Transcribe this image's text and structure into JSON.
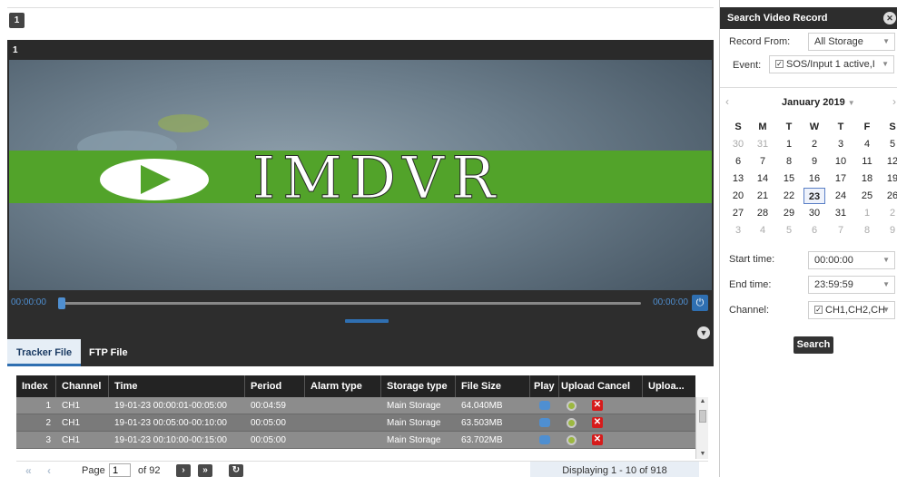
{
  "player": {
    "window_badge": "1",
    "channel_number": "1",
    "logo_text": "IMDVR",
    "time_start": "00:00:00",
    "time_end": "00:00:00",
    "progress_fraction": 0
  },
  "tabs": [
    {
      "label": "Tracker File",
      "active": true
    },
    {
      "label": "FTP File",
      "active": false
    }
  ],
  "table": {
    "columns": [
      "Index",
      "Channel",
      "Time",
      "Period",
      "Alarm type",
      "Storage type",
      "File Size",
      "Play",
      "Upload",
      "Cancel",
      "Uploa..."
    ],
    "rows": [
      {
        "index": "1",
        "channel": "CH1",
        "time": "19-01-23 00:00:01-00:05:00",
        "period": "00:04:59",
        "alarm_type": "",
        "storage_type": "Main Storage",
        "file_size": "64.040MB",
        "cancel": "✕"
      },
      {
        "index": "2",
        "channel": "CH1",
        "time": "19-01-23 00:05:00-00:10:00",
        "period": "00:05:00",
        "alarm_type": "",
        "storage_type": "Main Storage",
        "file_size": "63.503MB",
        "cancel": "✕"
      },
      {
        "index": "3",
        "channel": "CH1",
        "time": "19-01-23 00:10:00-00:15:00",
        "period": "00:05:00",
        "alarm_type": "",
        "storage_type": "Main Storage",
        "file_size": "63.702MB",
        "cancel": "✕"
      }
    ]
  },
  "pager": {
    "first": "«",
    "prev": "‹",
    "page_label": "Page",
    "page_value": "1",
    "of_label": "of 92",
    "next": "›",
    "last": "»",
    "refresh": "↻",
    "displaying": "Displaying 1 - 10 of 918"
  },
  "search_panel": {
    "title": "Search Video Record",
    "close": "✕",
    "record_from_label": "Record From:",
    "record_from_value": "All Storage",
    "event_label": "Event:",
    "event_value": "SOS/Input 1 active,I",
    "event_checked": "✓",
    "calendar": {
      "month_title": "January 2019",
      "prev": "‹",
      "next": "›",
      "weekdays": [
        "S",
        "M",
        "T",
        "W",
        "T",
        "F",
        "S"
      ],
      "weeks": [
        [
          "30",
          "31",
          "1",
          "2",
          "3",
          "4",
          "5"
        ],
        [
          "6",
          "7",
          "8",
          "9",
          "10",
          "11",
          "12"
        ],
        [
          "13",
          "14",
          "15",
          "16",
          "17",
          "18",
          "19"
        ],
        [
          "20",
          "21",
          "22",
          "23",
          "24",
          "25",
          "26"
        ],
        [
          "27",
          "28",
          "29",
          "30",
          "31",
          "1",
          "2"
        ],
        [
          "3",
          "4",
          "5",
          "6",
          "7",
          "8",
          "9"
        ]
      ],
      "selected": "23"
    },
    "start_time_label": "Start time:",
    "start_time_value": "00:00:00",
    "end_time_label": "End time:",
    "end_time_value": "23:59:59",
    "channel_label": "Channel:",
    "channel_value": "CH1,CH2,CH",
    "channel_checked": "✓",
    "search_label": "Search"
  },
  "colors": {
    "accent": "#2f6fb1",
    "dark_bar": "#2d2d2d",
    "logo_green": "#52a32a",
    "cancel_red": "#d61b1b"
  },
  "icons": {
    "play": "play-icon",
    "upload": "upload-icon",
    "cancel": "cancel-icon",
    "power": "power-icon",
    "close": "close-icon",
    "chevron": "chevron-down-icon",
    "refresh": "refresh-icon"
  }
}
